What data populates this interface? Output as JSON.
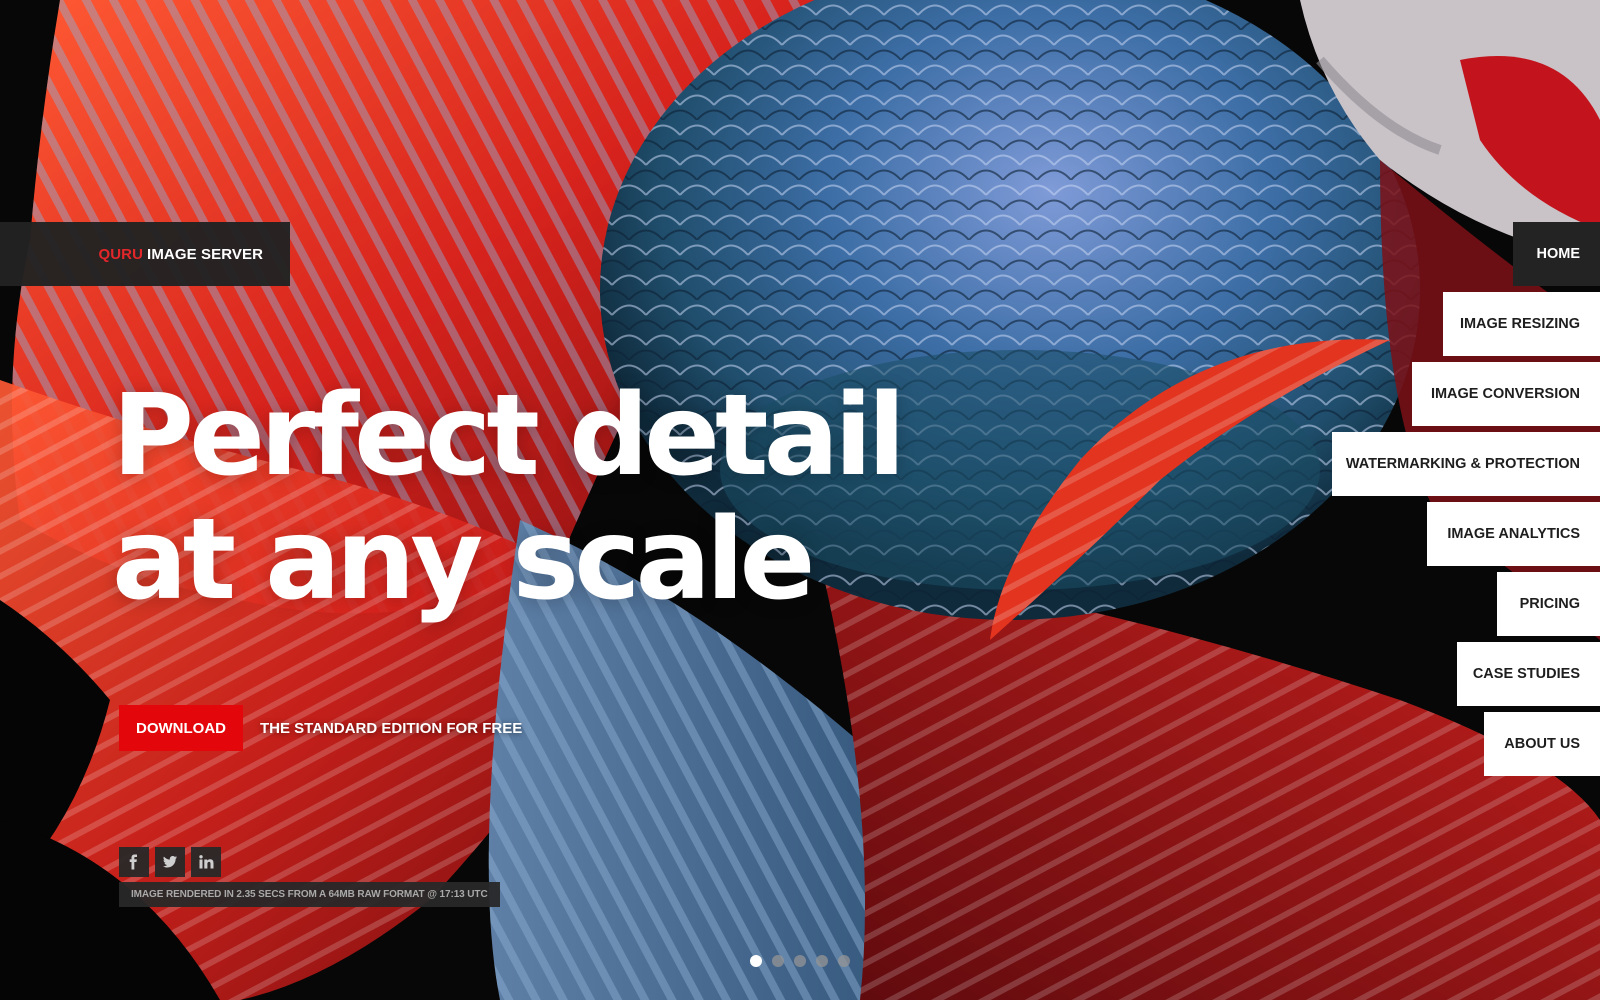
{
  "brand": {
    "accent": "QURU",
    "name": "IMAGE SERVER",
    "accent_color": "#e3262a"
  },
  "nav": {
    "items": [
      {
        "label": "HOME",
        "active": true
      },
      {
        "label": "IMAGE RESIZING",
        "active": false
      },
      {
        "label": "IMAGE CONVERSION",
        "active": false
      },
      {
        "label": "WATERMARKING & PROTECTION",
        "active": false
      },
      {
        "label": "IMAGE ANALYTICS",
        "active": false
      },
      {
        "label": "PRICING",
        "active": false
      },
      {
        "label": "CASE STUDIES",
        "active": false
      },
      {
        "label": "ABOUT US",
        "active": false
      }
    ]
  },
  "hero": {
    "headline_line1": "Perfect detail",
    "headline_line2": "at any scale",
    "download_label": "DOWNLOAD",
    "download_color": "#e3060b",
    "cta_note": "THE STANDARD EDITION FOR FREE",
    "render_note": "IMAGE RENDERED IN 2.35 SECS FROM A 64MB RAW FORMAT @ 17:13 UTC"
  },
  "social": {
    "icons": [
      "facebook-icon",
      "twitter-icon",
      "linkedin-icon"
    ]
  },
  "slider": {
    "total": 5,
    "active_index": 0
  }
}
